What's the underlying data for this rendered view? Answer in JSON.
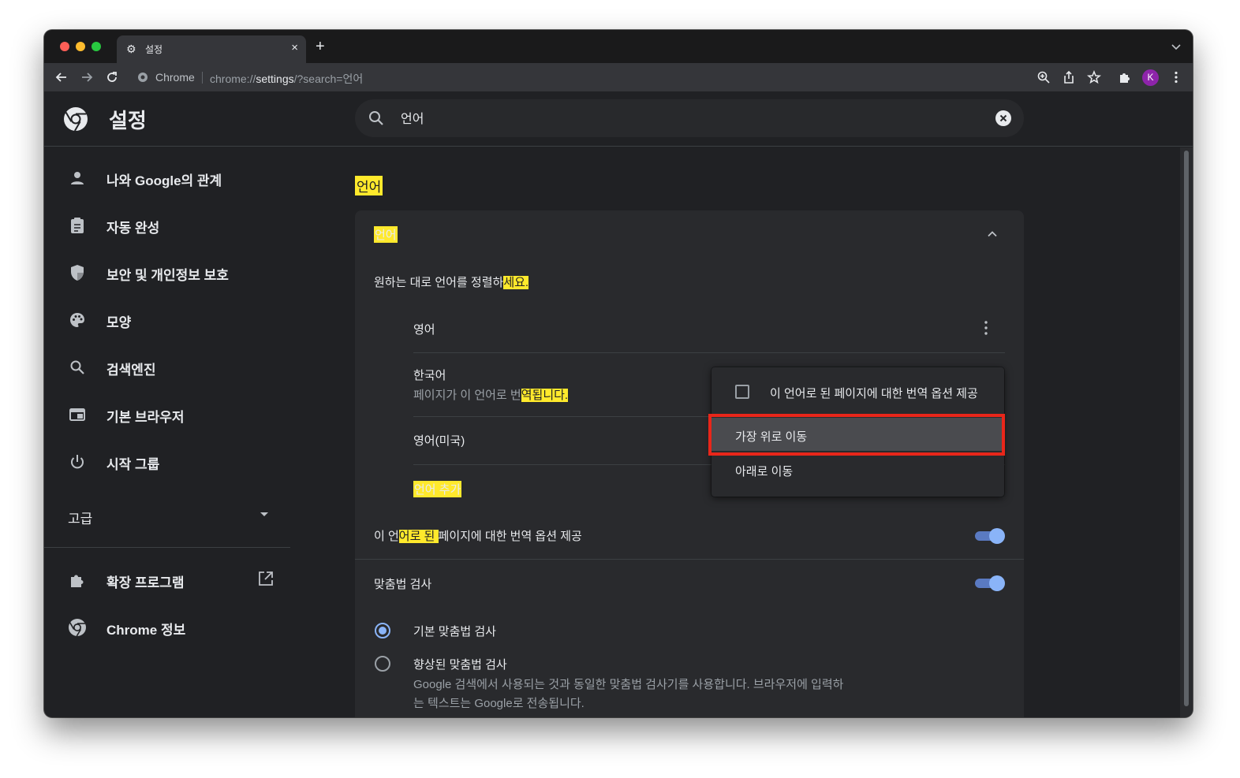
{
  "window": {
    "tab_title": "설정",
    "tab_close": "×",
    "new_tab": "+",
    "omnibox_chip": "Chrome",
    "omnibox_url_prefix": "chrome://",
    "omnibox_url_host": "settings",
    "omnibox_url_rest": "/?search=언어",
    "avatar_letter": "K"
  },
  "header": {
    "title": "설정",
    "search_value": "언어"
  },
  "sidebar": {
    "items": [
      {
        "label": "나와 Google의 관계",
        "icon": "person-icon"
      },
      {
        "label": "자동 완성",
        "icon": "clipboard-icon"
      },
      {
        "label": "보안 및 개인정보 보호",
        "icon": "shield-icon"
      },
      {
        "label": "모양",
        "icon": "palette-icon"
      },
      {
        "label": "검색엔진",
        "icon": "search-icon"
      },
      {
        "label": "기본 브라우저",
        "icon": "browser-icon"
      },
      {
        "label": "시작 그룹",
        "icon": "power-icon"
      }
    ],
    "advanced_label": "고급",
    "extensions_label": "확장 프로그램",
    "about_label": "Chrome 정보"
  },
  "main": {
    "section_title": "언어",
    "card_title": "언어",
    "order_hint_plain": "원하는 대로 언어를 정렬하",
    "order_hint_hl": "세요.",
    "languages": [
      {
        "name": "영어"
      },
      {
        "name": "한국어",
        "sub_plain": "페이지가 이 언어로 번",
        "sub_hl": "역됩니다."
      },
      {
        "name": "영어(미국)"
      }
    ],
    "add_language": "언어 추가",
    "translate_offer_pre": "이 언",
    "translate_offer_hl": "어로 된 ",
    "translate_offer_post": "페이지에 대한 번역 옵션 제공",
    "translate_offer_on": true,
    "spellcheck_label": "맞춤법 검사",
    "spellcheck_on": true,
    "basic_spellcheck": "기본 맞춤법 검사",
    "enhanced_spellcheck": "향상된 맞춤법 검사",
    "enhanced_desc_line1": "Google 검색에서 사용되는 것과 동일한 맞춤법 검사기를 사용합니다. 브라우저에 입력하",
    "enhanced_desc_line2": "는 텍스트는 Google로 전송됩니다."
  },
  "menu": {
    "offer_translate": "이 언어로 된 페이지에 대한 번역 옵션 제공",
    "move_top": "가장 위로 이동",
    "move_down": "아래로 이동"
  },
  "colors": {
    "accent": "#8ab4f8",
    "highlight": "#ffe92c",
    "annotation_red": "#e8261a"
  }
}
